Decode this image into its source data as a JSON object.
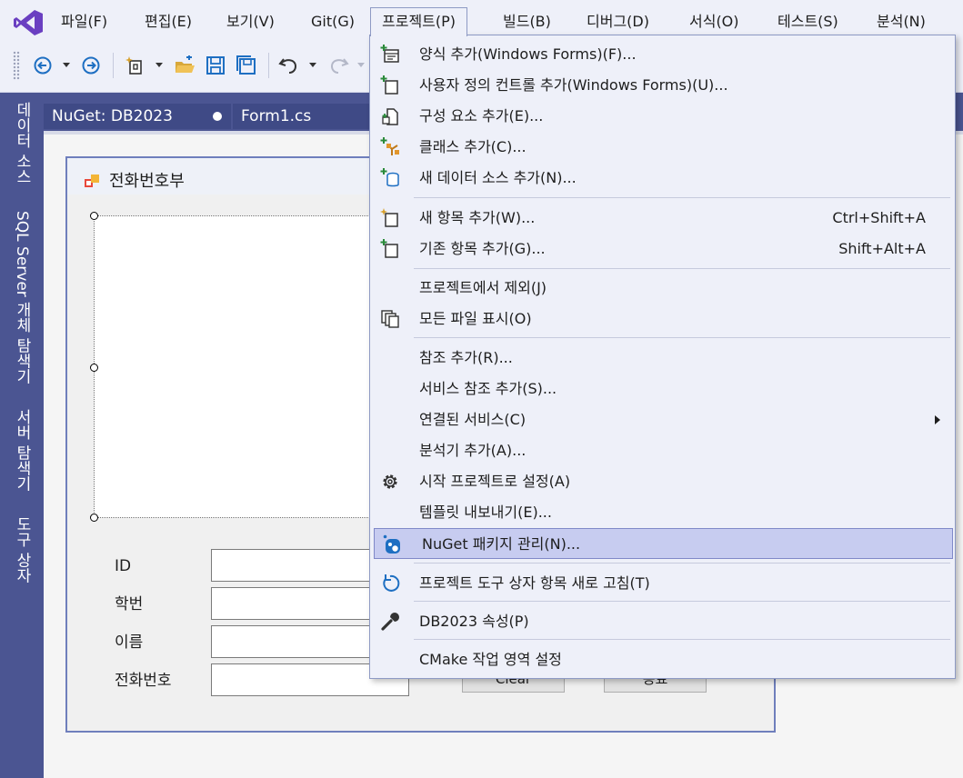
{
  "colors": {
    "menu_bg": "#eef0f9",
    "tool_strip": "#4b5592",
    "accent": "#1e88e5",
    "vs_purple": "#6a3fc1",
    "highlight": "#c7ccf0"
  },
  "menubar": {
    "items": [
      {
        "label": "파일(F)"
      },
      {
        "label": "편집(E)"
      },
      {
        "label": "보기(V)"
      },
      {
        "label": "Git(G)"
      },
      {
        "label": "프로젝트(P)"
      },
      {
        "label": "빌드(B)"
      },
      {
        "label": "디버그(D)"
      },
      {
        "label": "서식(O)"
      },
      {
        "label": "테스트(S)"
      },
      {
        "label": "분석(N)"
      }
    ]
  },
  "toolbar": {
    "icons": [
      "back-icon",
      "forward-icon",
      "new-project-icon",
      "open-folder-icon",
      "save-icon",
      "save-all-icon",
      "undo-icon",
      "redo-icon"
    ]
  },
  "left_tabs": [
    {
      "label": "데이터 소스"
    },
    {
      "label": "SQL Server 개체 탐색기"
    },
    {
      "label": "서버 탐색기"
    },
    {
      "label": "도구 상자"
    }
  ],
  "doc_tabs": [
    {
      "label": "NuGet: DB2023"
    },
    {
      "label": "Form1.cs"
    }
  ],
  "form": {
    "title": "전화번호부",
    "labels": [
      "ID",
      "학번",
      "이름",
      "전화번호"
    ],
    "buttons": [
      "Clear",
      "종료"
    ]
  },
  "project_menu": {
    "items": [
      {
        "label": "양식 추가(Windows Forms)(F)...",
        "icon": "add-form-icon"
      },
      {
        "label": "사용자 정의 컨트롤 추가(Windows Forms)(U)...",
        "icon": "add-user-control-icon"
      },
      {
        "label": "구성 요소 추가(E)...",
        "icon": "add-component-icon"
      },
      {
        "label": "클래스 추가(C)...",
        "icon": "add-class-icon"
      },
      {
        "label": "새 데이터 소스 추가(N)...",
        "icon": "add-data-source-icon"
      },
      {
        "label": "새 항목 추가(W)...",
        "shortcut": "Ctrl+Shift+A",
        "icon": "new-item-icon"
      },
      {
        "label": "기존 항목 추가(G)...",
        "shortcut": "Shift+Alt+A",
        "icon": "existing-item-icon"
      },
      {
        "label": "프로젝트에서 제외(J)"
      },
      {
        "label": "모든 파일 표시(O)",
        "icon": "show-all-files-icon"
      },
      {
        "label": "참조 추가(R)..."
      },
      {
        "label": "서비스 참조 추가(S)..."
      },
      {
        "label": "연결된 서비스(C)",
        "submenu": true
      },
      {
        "label": "분석기 추가(A)..."
      },
      {
        "label": "시작 프로젝트로 설정(A)",
        "icon": "gear-icon"
      },
      {
        "label": "템플릿 내보내기(E)..."
      },
      {
        "label": "NuGet 패키지 관리(N)...",
        "icon": "nuget-icon",
        "highlighted": true
      },
      {
        "label": "프로젝트 도구 상자 항목 새로 고침(T)",
        "icon": "refresh-icon"
      },
      {
        "label": "DB2023 속성(P)",
        "icon": "wrench-icon"
      },
      {
        "label": "CMake 작업 영역 설정"
      }
    ]
  }
}
